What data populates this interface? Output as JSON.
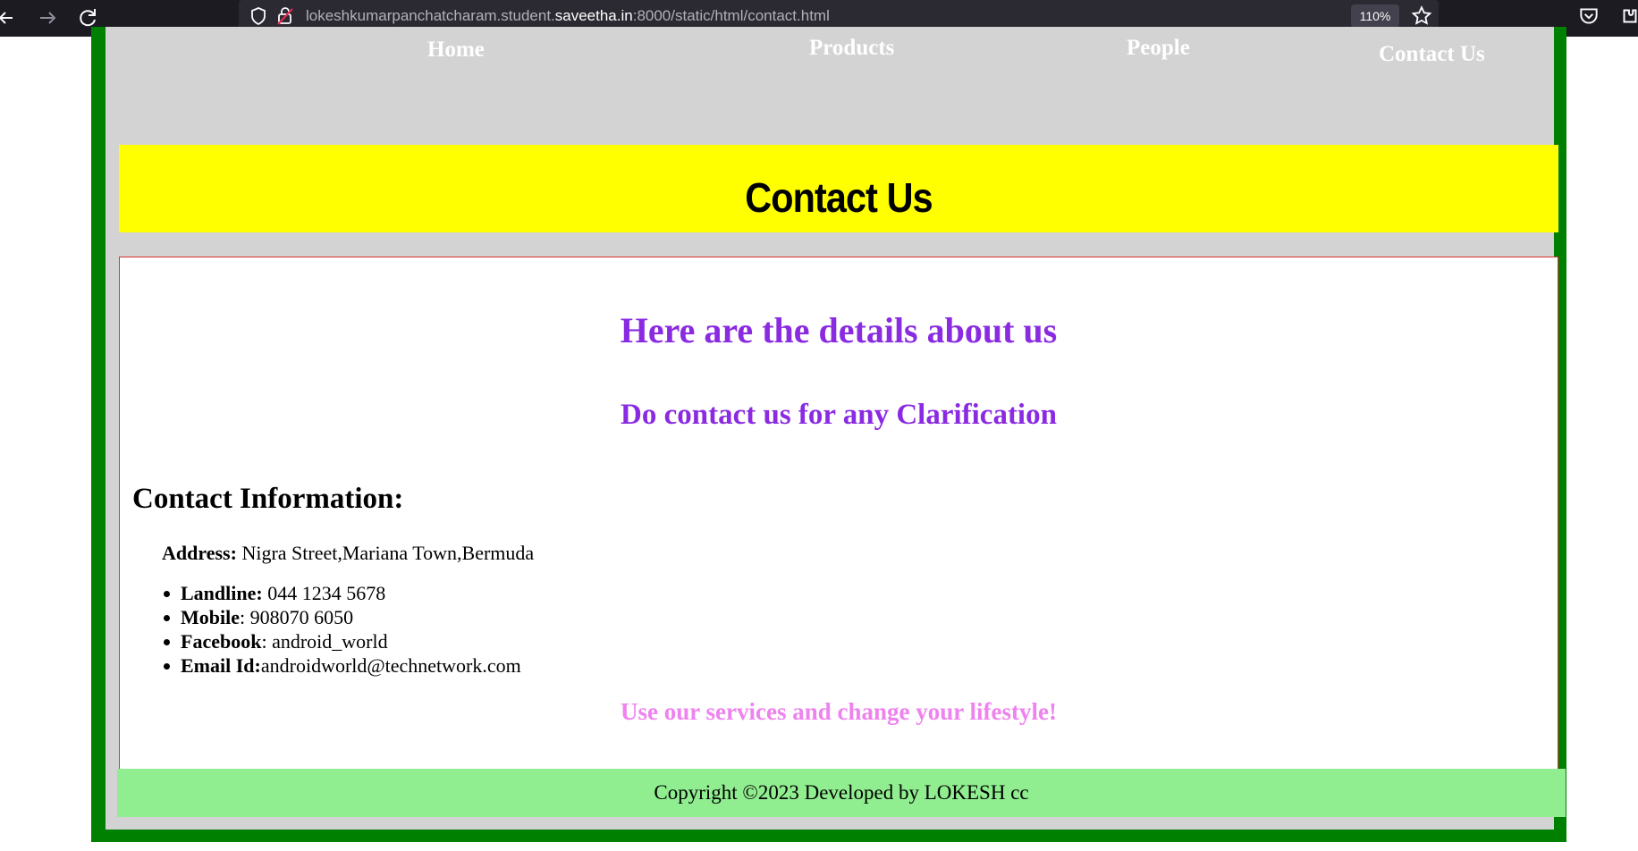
{
  "browser": {
    "url_prefix": "lokeshkumarpanchatcharam.student.",
    "url_domain": "saveetha.in",
    "url_suffix": ":8000/static/html/contact.html",
    "zoom": "110%"
  },
  "nav": {
    "home": "Home",
    "products": "Products",
    "people": "People",
    "contact": "Contact Us"
  },
  "banner": {
    "title": "Contact Us"
  },
  "content": {
    "heading_details": "Here are the details about us",
    "heading_clarify": "Do contact us for any Clarification",
    "heading_info": "Contact Information:",
    "address_label": "Address:",
    "address_value": " Nigra Street,Mariana Town,Bermuda",
    "contacts": [
      {
        "label": "Landline:",
        "value": " 044 1234 5678"
      },
      {
        "label": "Mobile",
        "value": ": 908070 6050"
      },
      {
        "label": "Facebook",
        "value": ": android_world"
      },
      {
        "label": "Email Id:",
        "value": "androidworld@technetwork.com"
      }
    ],
    "tagline": "Use our services and change your lifestyle!"
  },
  "footer": {
    "text": "Copyright ©2023 Developed by LOKESH cc"
  },
  "colors": {
    "frame": "#008000",
    "page_bg": "#d3d3d3",
    "banner": "#ffff00",
    "heading": "#8a2be2",
    "tagline": "#ee82ee",
    "footer": "#90ee90"
  }
}
